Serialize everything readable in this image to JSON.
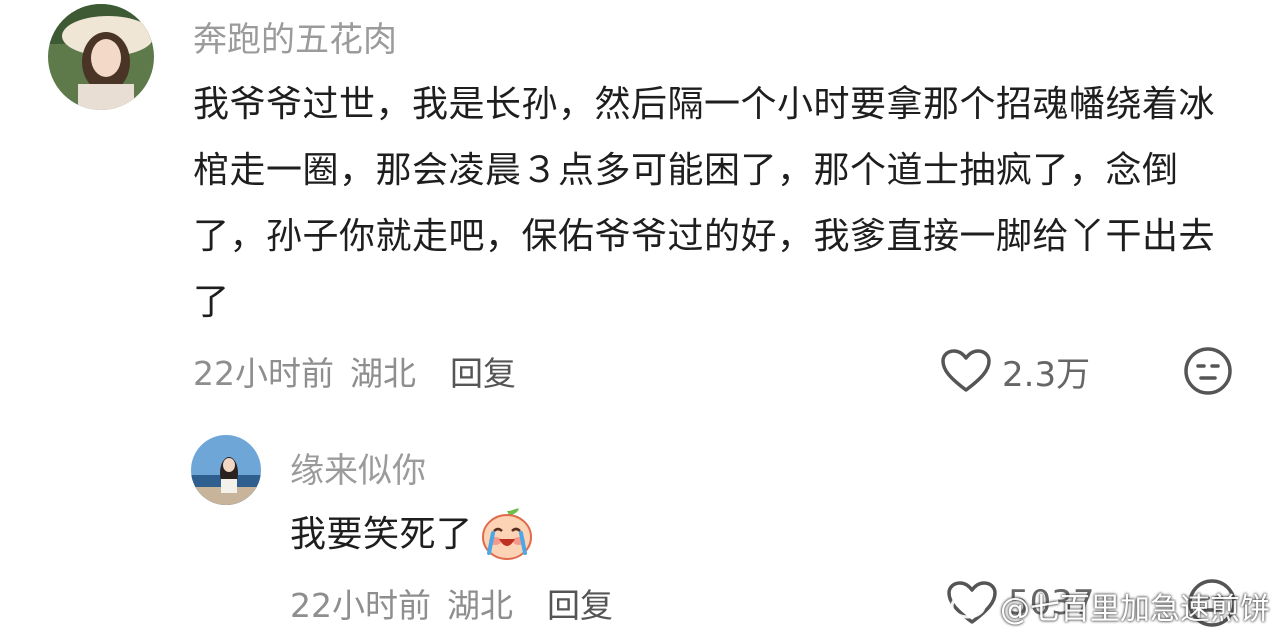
{
  "comments": [
    {
      "username": "奔跑的五花肉",
      "text": "我爷爷过世，我是长孙，然后隔一个小时要拿那个招魂幡绕着冰棺走一圈，那会凌晨３点多可能困了，那个道士抽疯了，念倒了，孙子你就走吧，保佑爷爷过的好，我爹直接一脚给丫干出去了",
      "time": "22小时前",
      "region": "湖北",
      "reply_label": "回复",
      "like_count": "2.3万",
      "like_icon": "heart-outline-icon",
      "dislike_icon": "meh-face-icon"
    },
    {
      "username": "缘来似你",
      "text": "我要笑死了",
      "emoji": "crying-laughing-peach-emoji",
      "time": "22小时前",
      "region": "湖北",
      "reply_label": "回复",
      "like_count": "5037",
      "like_icon": "heart-outline-icon",
      "dislike_icon": "meh-face-icon"
    }
  ],
  "watermark": {
    "text": "@七百里加急速煎饼",
    "icon": "weibo-logo-icon"
  }
}
